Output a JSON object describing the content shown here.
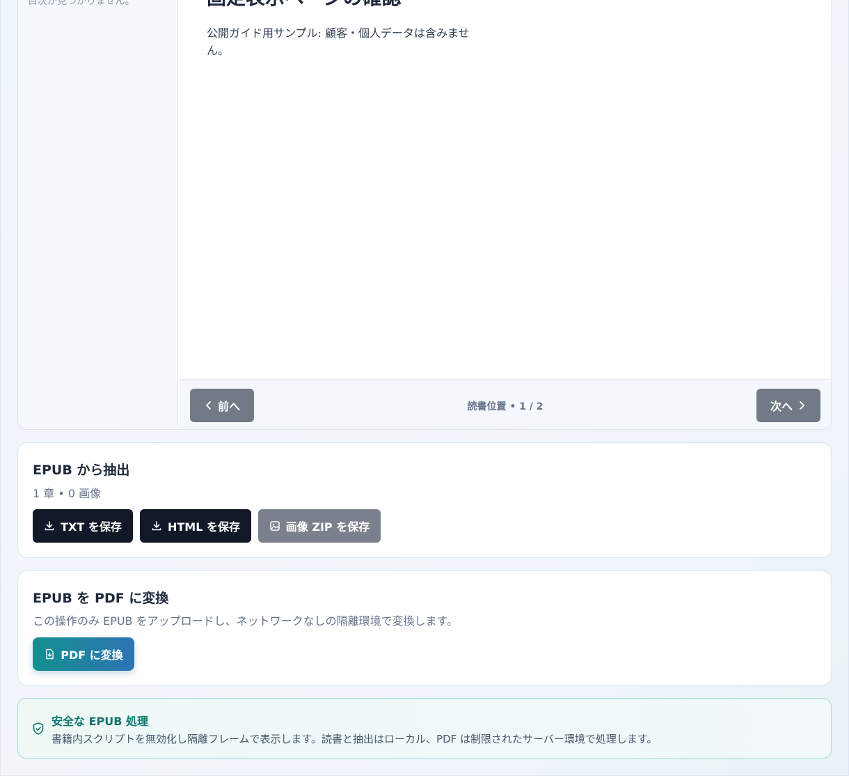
{
  "reader": {
    "sidebar_empty": "目次が見つかりません。",
    "chapter_title": "固定表示ページの確認",
    "chapter_body": "公開ガイド用サンプル: 顧客・個人データは含みません。",
    "prev_label": "前へ",
    "next_label": "次へ",
    "position": "読書位置 • 1 / 2"
  },
  "extract": {
    "title": "EPUB から抽出",
    "summary": "1 章 • 0 画像",
    "txt_label": "TXT を保存",
    "html_label": "HTML を保存",
    "zip_label": "画像 ZIP を保存"
  },
  "convert": {
    "title": "EPUB を PDF に変換",
    "description": "この操作のみ EPUB をアップロードし、ネットワークなしの隔離環境で変換します。",
    "pdf_label": "PDF に変換"
  },
  "notice": {
    "title": "安全な EPUB 処理",
    "text": "書籍内スクリプトを無効化し隔離フレームで表示します。読書と抽出はローカル、PDF は制限されたサーバー環境で処理します。"
  },
  "colors": {
    "accent_teal": "#12908e",
    "accent_blue": "#2f74b5",
    "dark_button": "#111827",
    "disabled_button": "#7b818c",
    "notice_title": "#0f766e"
  },
  "icons": {
    "prev": "chevron-left-icon",
    "next": "chevron-right-icon",
    "txt": "download-icon",
    "html": "download-icon",
    "zip": "image-icon",
    "pdf": "file-download-icon",
    "notice": "shield-check-icon"
  }
}
